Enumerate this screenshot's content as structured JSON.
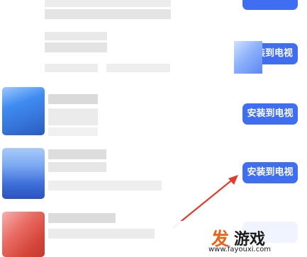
{
  "app_list": {
    "items": [
      {
        "action_label": ""
      },
      {
        "action_label": "装到电视"
      },
      {
        "action_label": "安装到电视"
      },
      {
        "action_label": "安装到电视"
      },
      {
        "action_label": ""
      }
    ]
  },
  "watermark": {
    "logo_text_1": "发",
    "logo_text_2": "游戏",
    "url": "www.fayouxi.com"
  },
  "colors": {
    "button_blue": "#3f6ff0",
    "arrow_red": "#e23a2c",
    "watermark_orange": "#e8641b"
  }
}
